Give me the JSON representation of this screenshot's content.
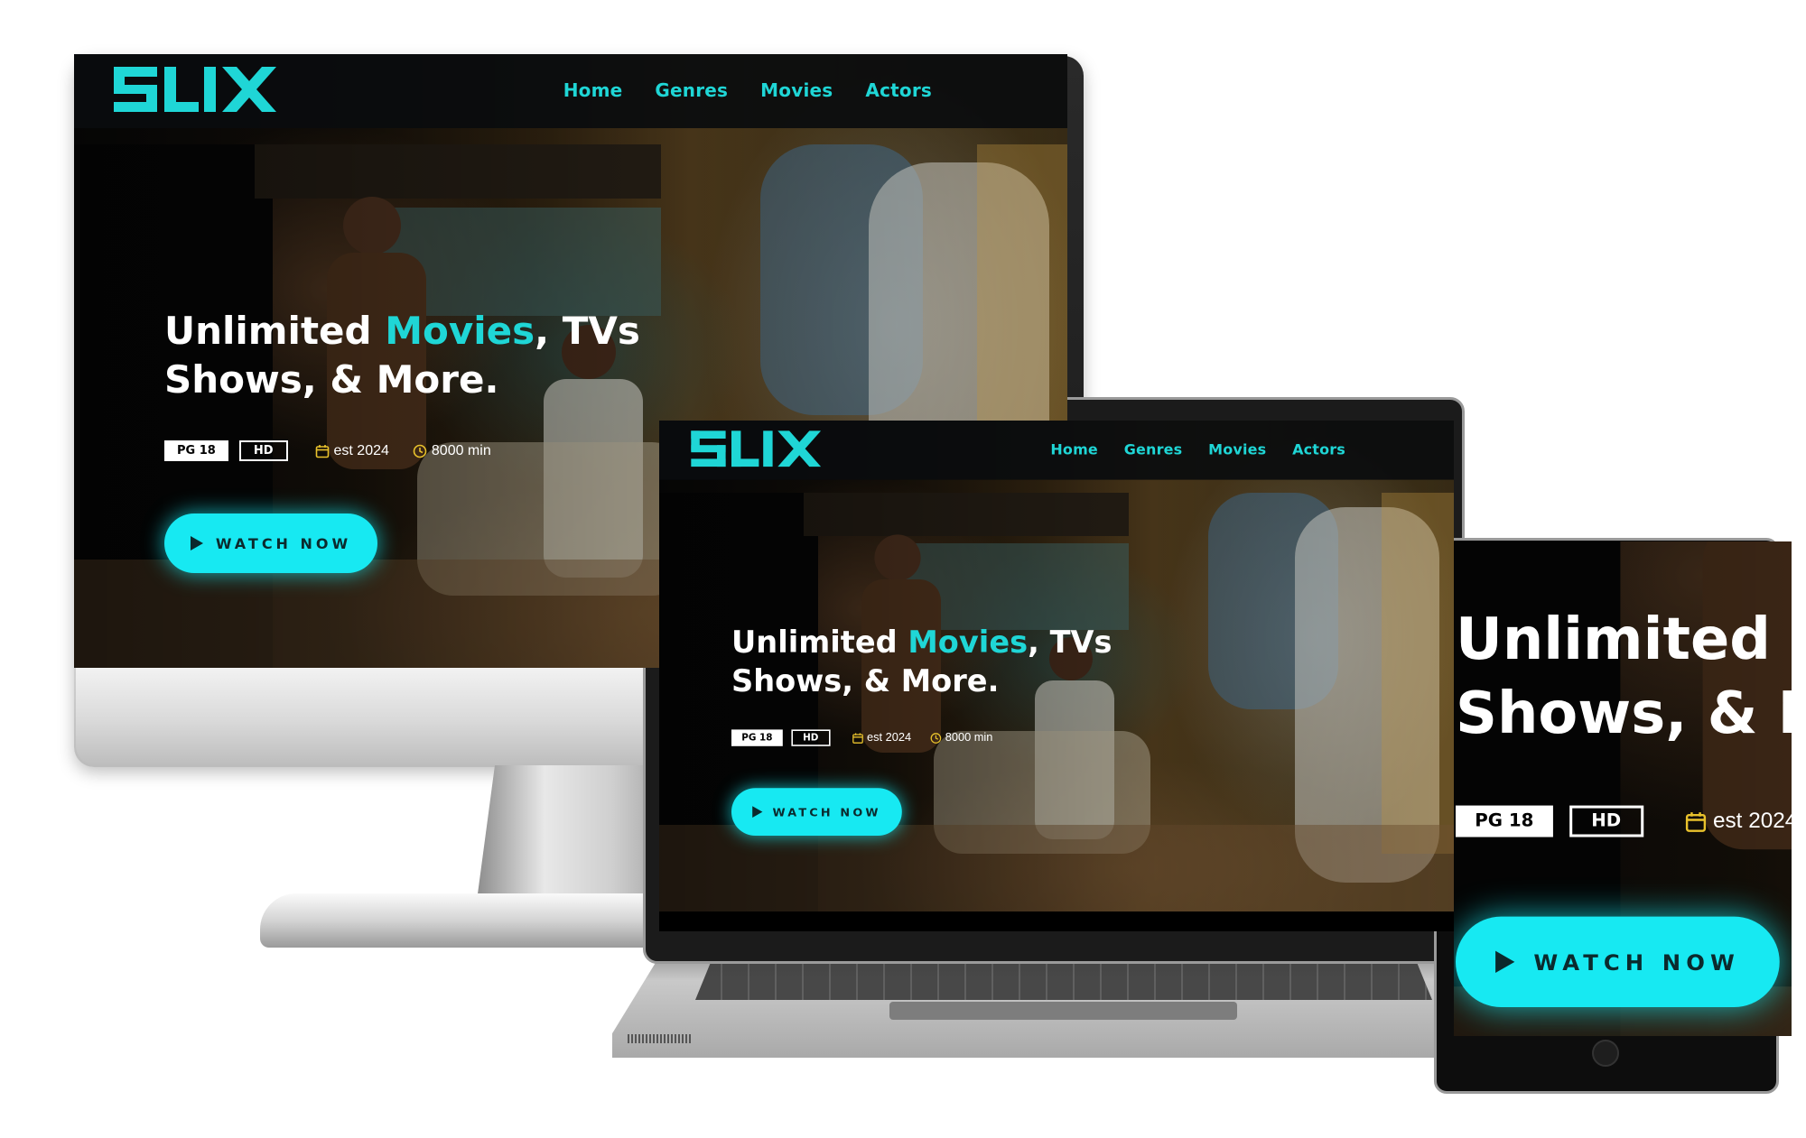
{
  "site": {
    "logo_text": "SLIX",
    "nav": [
      "Home",
      "Genres",
      "Movies",
      "Actors"
    ],
    "hero": {
      "title_part1": "Unlimited ",
      "title_accent": "Movies",
      "title_part2": ", TVs Shows, & More."
    },
    "meta": {
      "rating": "PG 18",
      "quality": "HD",
      "year": "est 2024",
      "duration": "8000 min"
    },
    "cta": "WATCH NOW"
  },
  "icons": [
    "calendar-icon",
    "clock-icon",
    "play-icon"
  ],
  "colors": {
    "accent": "#1fd6d6",
    "button": "#17e9f2",
    "meta_icon": "#e9c22c"
  }
}
